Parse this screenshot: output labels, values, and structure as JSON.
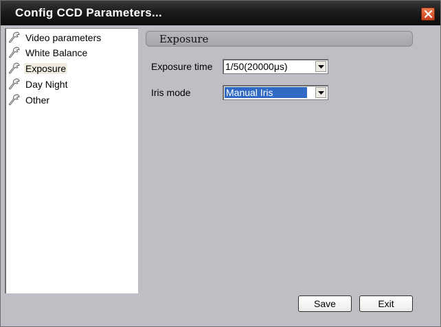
{
  "window": {
    "title": "Config CCD Parameters...",
    "close_icon": "close-icon"
  },
  "sidebar": {
    "items": [
      {
        "label": "Video parameters",
        "icon": "wrench-icon",
        "selected": false
      },
      {
        "label": "White Balance",
        "icon": "wrench-icon",
        "selected": false
      },
      {
        "label": "Exposure",
        "icon": "wrench-icon",
        "selected": true
      },
      {
        "label": "Day Night",
        "icon": "wrench-icon",
        "selected": false
      },
      {
        "label": "Other",
        "icon": "wrench-icon",
        "selected": false
      }
    ]
  },
  "main": {
    "section_title": "Exposure",
    "exposure_time": {
      "label": "Exposure time",
      "value": "1/50(20000μs)"
    },
    "iris_mode": {
      "label": "Iris mode",
      "value": "Manual Iris"
    }
  },
  "buttons": {
    "save": "Save",
    "exit": "Exit"
  },
  "colors": {
    "titlebar": "#111111",
    "background": "#c0bec4",
    "selection": "#316ac5",
    "close": "#d9542a"
  }
}
